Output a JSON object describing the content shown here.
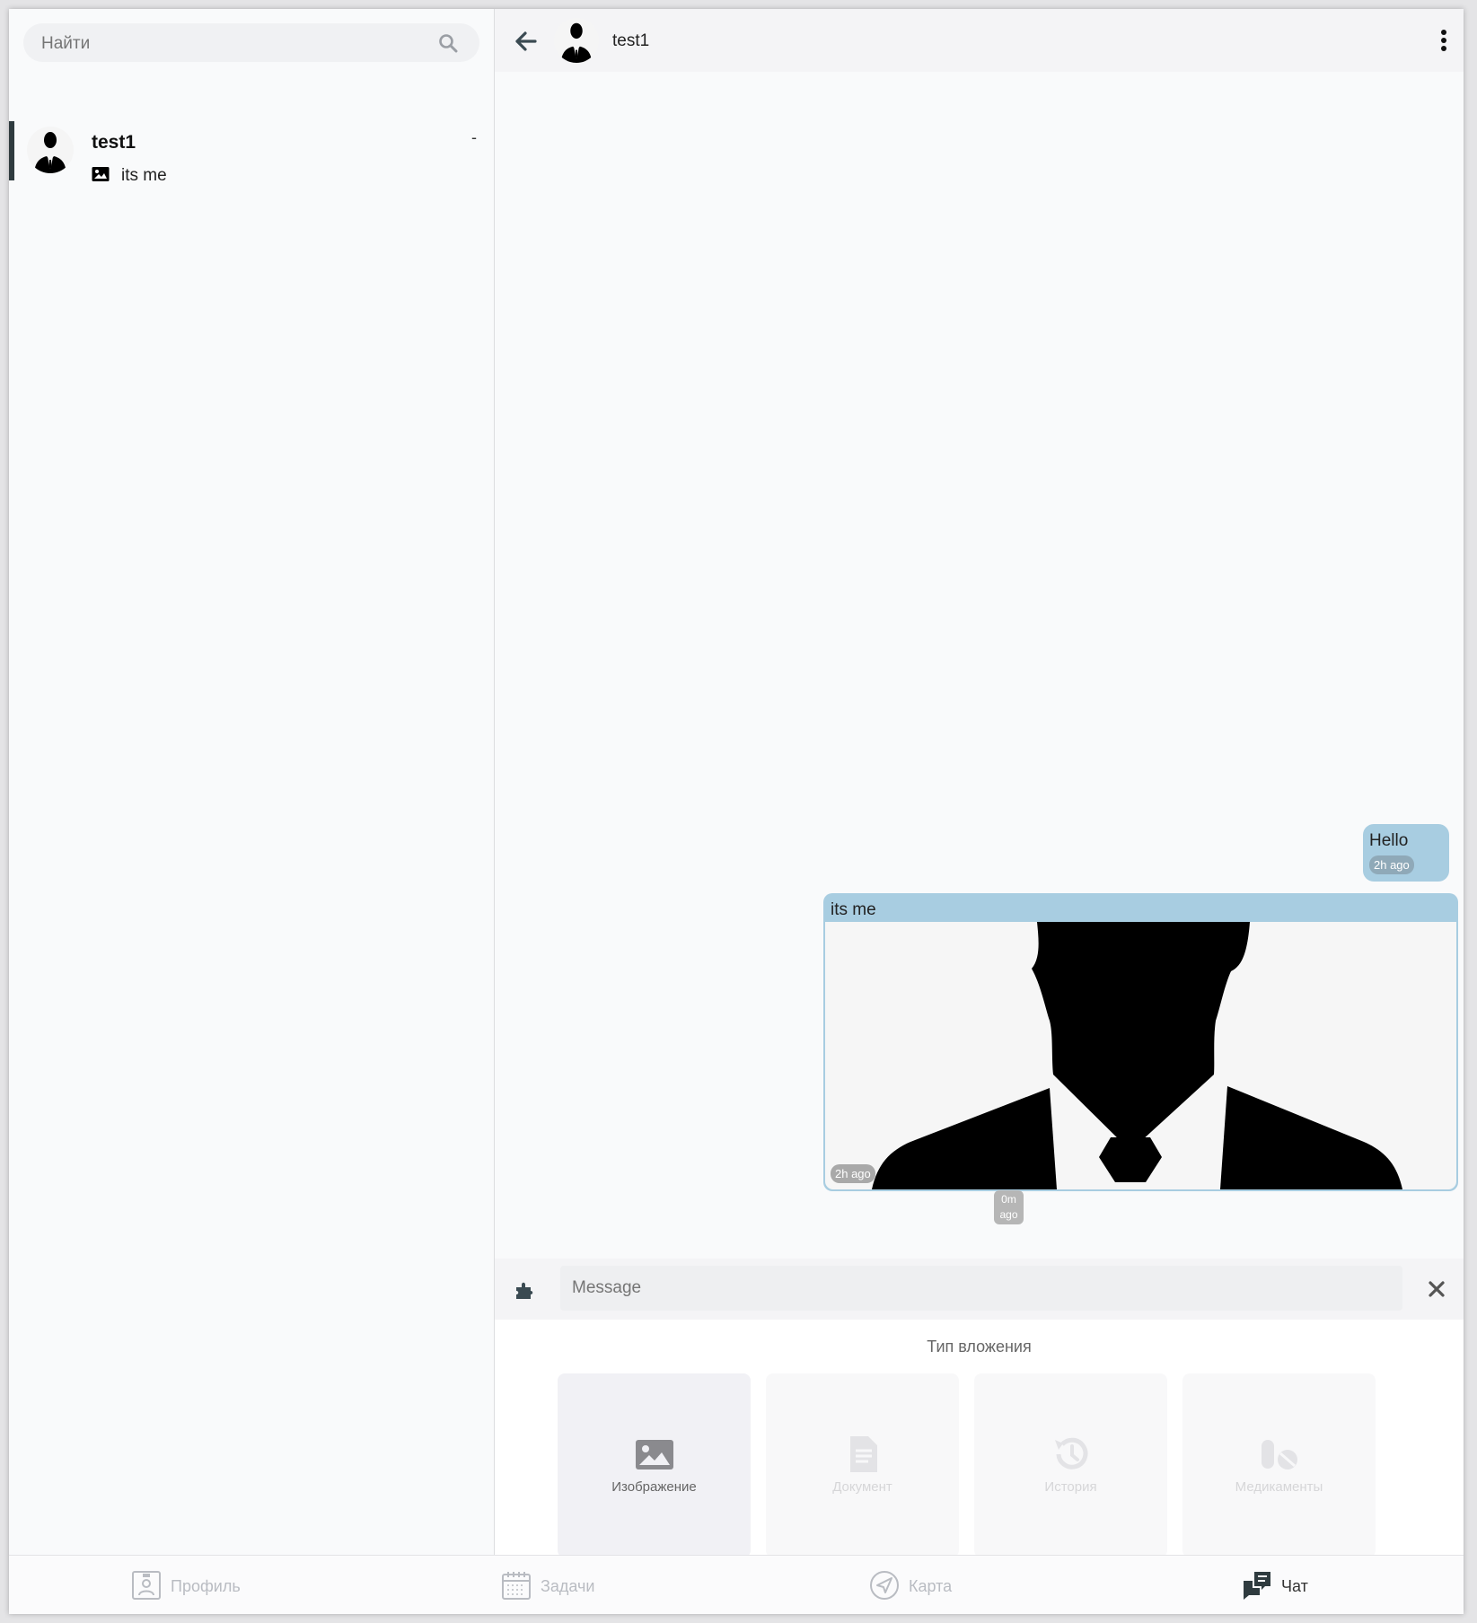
{
  "search": {
    "placeholder": "Найти"
  },
  "conversations": [
    {
      "name": "test1",
      "meta": "-",
      "last_message": "its me",
      "last_message_icon": "image-icon"
    }
  ],
  "chat": {
    "contact_name": "test1",
    "messages": [
      {
        "text": "Hello",
        "time": "2h ago"
      },
      {
        "text": "its me",
        "time": "2h ago",
        "attachment": "image"
      }
    ],
    "pending_time": [
      "0m",
      "ago"
    ]
  },
  "composer": {
    "placeholder": "Message"
  },
  "attachment_panel": {
    "title": "Тип вложения",
    "options": [
      {
        "label": "Изображение",
        "icon": "image-icon",
        "enabled": true
      },
      {
        "label": "Документ",
        "icon": "document-icon",
        "enabled": false
      },
      {
        "label": "История",
        "icon": "history-icon",
        "enabled": false
      },
      {
        "label": "Медикаменты",
        "icon": "pills-icon",
        "enabled": false
      }
    ]
  },
  "bottom_nav": [
    {
      "label": "Профиль",
      "icon": "profile-icon",
      "active": false
    },
    {
      "label": "Задачи",
      "icon": "calendar-icon",
      "active": false
    },
    {
      "label": "Карта",
      "icon": "navigation-icon",
      "active": false
    },
    {
      "label": "Чат",
      "icon": "chat-icon",
      "active": true
    }
  ],
  "colors": {
    "accent_bar": "#2f3b3f",
    "bubble": "#a8cde1",
    "time_chip": "#8fa9b8"
  }
}
